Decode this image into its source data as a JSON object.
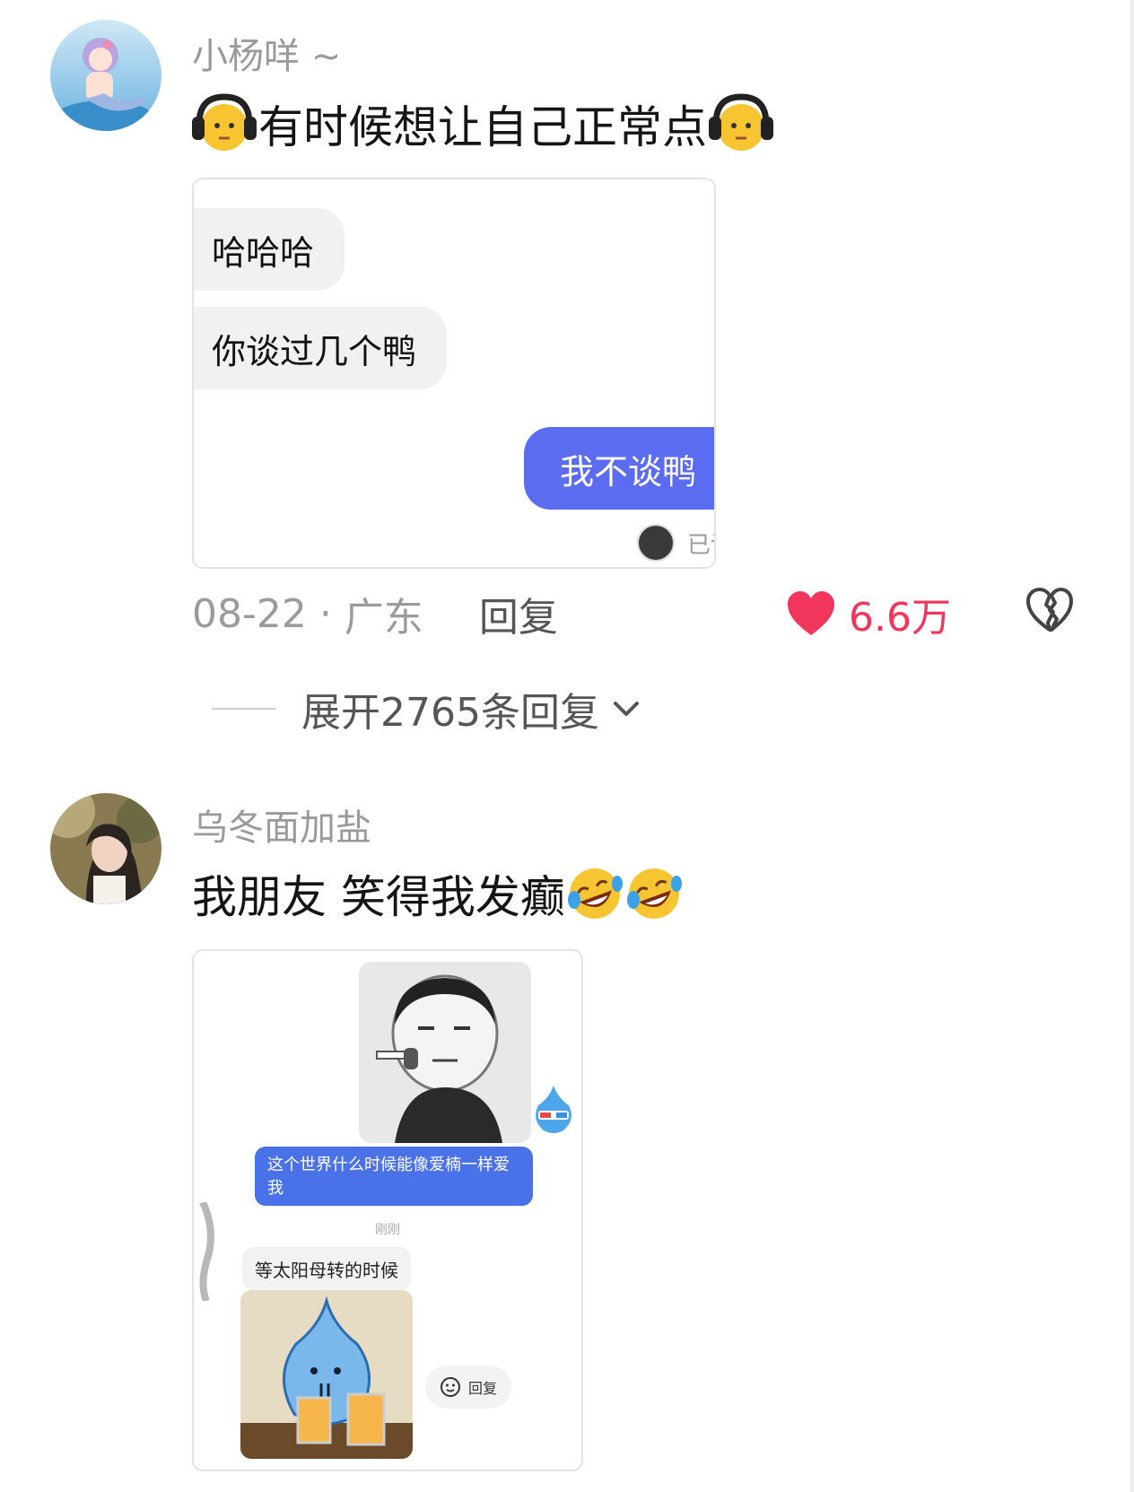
{
  "comments": [
    {
      "username": "小杨咩 ~",
      "text": "有时候想让自己正常点",
      "emoji": "headphone-face-icon",
      "screenshot": {
        "messages_in": [
          "哈哈哈",
          "你谈过几个鸭"
        ],
        "message_out": "我不谈鸭",
        "read_status": "已读"
      },
      "date": "08-22",
      "location": "广东",
      "reply_label": "回复",
      "like_count": "6.6万",
      "expand_label": "展开2765条回复"
    },
    {
      "username": "乌冬面加盐",
      "text": "我朋友 笑得我发癫",
      "emoji": "rofl-face-icon",
      "screenshot": {
        "sent_message": "这个世界什么时候能像爱楠一样爱我",
        "time": "刚刚",
        "reply_message": "等太阳母转的时候",
        "reply_label": "回复"
      }
    }
  ],
  "colors": {
    "like_red": "#f2365b",
    "bubble_blue": "#5b6cf0",
    "meta_grey": "#9b9b9b"
  }
}
